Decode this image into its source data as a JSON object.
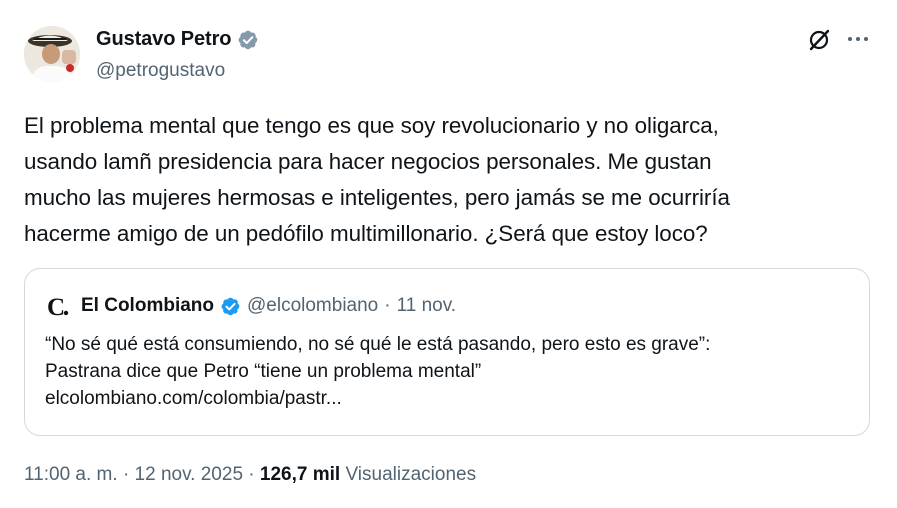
{
  "author": {
    "display_name": "Gustavo Petro",
    "handle": "@petrogustavo"
  },
  "tweet": {
    "lines": [
      "El problema mental que tengo es que soy revolucionario y no oligarca,",
      "usando lamñ presidencia para hacer negocios personales. Me gustan",
      "mucho las mujeres hermosas e inteligentes, pero jamás se me ocurriría",
      "hacerme amigo de un pedófilo multimillonario. ¿Será que estoy loco?"
    ]
  },
  "quote": {
    "logo_letter": "C",
    "display_name": "El Colombiano",
    "handle": "@elcolombiano",
    "separator": "·",
    "date": "11 nov.",
    "lines": [
      "“No sé qué está consumiendo, no sé qué le está pasando, pero esto es grave”:",
      "Pastrana dice que Petro “tiene un problema mental”",
      "elcolombiano.com/colombia/pastr..."
    ]
  },
  "meta": {
    "time": "11:00 a. m.",
    "sep1": "·",
    "date": "12 nov. 2025",
    "sep2": "·",
    "views_count": "126,7 mil",
    "views_label": "Visualizaciones"
  },
  "icons": {
    "verified": "verified-badge-icon",
    "grok": "grok-icon",
    "more": "more-options-icon"
  },
  "colors": {
    "verified_blue": "#1d9bf0",
    "text_primary": "#0f1419",
    "text_secondary": "#536471",
    "border": "#cfd9de"
  }
}
